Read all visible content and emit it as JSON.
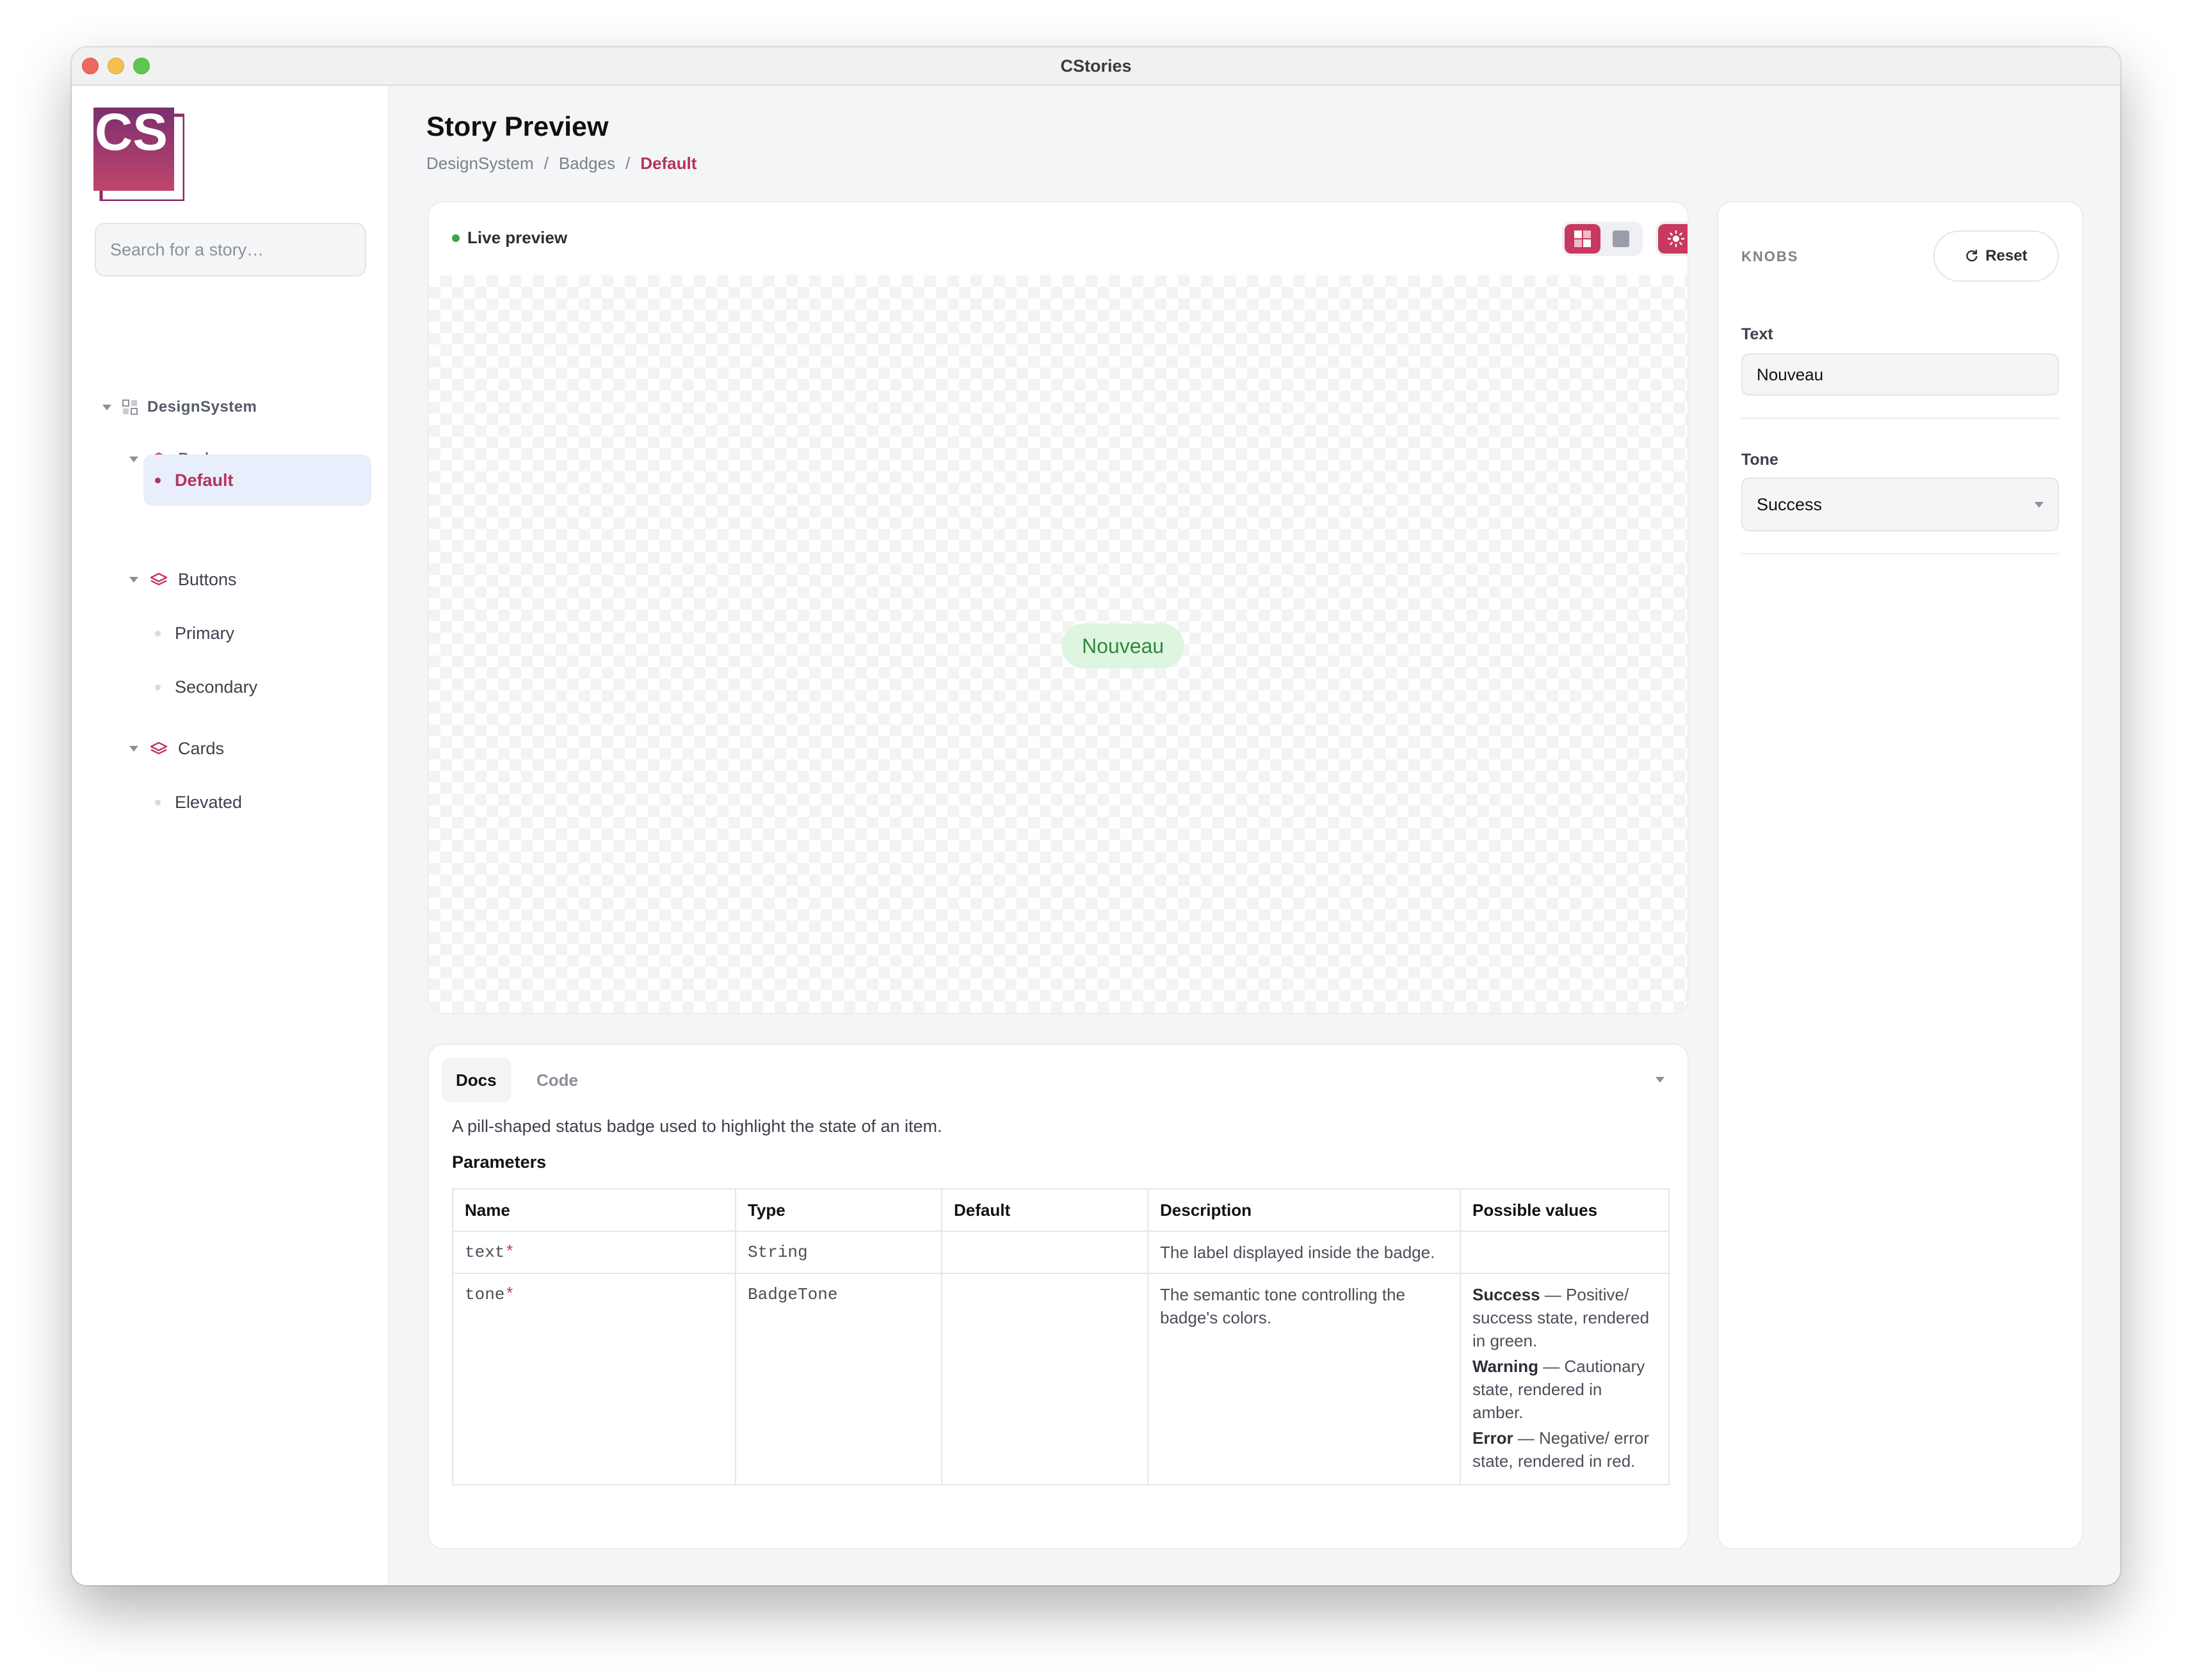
{
  "window": {
    "title": "CStories"
  },
  "sidebar": {
    "logo_text": "CS",
    "search_placeholder": "Search for a story…",
    "root": {
      "label": "DesignSystem"
    },
    "groups": [
      {
        "label": "Badges",
        "items": [
          {
            "label": "Default",
            "active": true
          }
        ]
      },
      {
        "label": "Buttons",
        "items": [
          {
            "label": "Primary"
          },
          {
            "label": "Secondary"
          }
        ]
      },
      {
        "label": "Cards",
        "items": [
          {
            "label": "Elevated"
          }
        ]
      }
    ]
  },
  "header": {
    "title": "Story Preview",
    "breadcrumb": [
      "DesignSystem",
      "/",
      "Badges",
      "/",
      "Default"
    ]
  },
  "preview": {
    "live_label": "Live preview",
    "badge_text": "Nouveau"
  },
  "docs": {
    "tabs": [
      "Docs",
      "Code"
    ],
    "description": "A pill-shaped status badge used to highlight the state of an item.",
    "parameters_heading": "Parameters",
    "columns": [
      "Name",
      "Type",
      "Default",
      "Description",
      "Possible values"
    ],
    "rows": [
      {
        "name": "text",
        "required": "*",
        "type": "String",
        "default": "",
        "description": "The label displayed inside the badge."
      },
      {
        "name": "tone",
        "required": "*",
        "type": "BadgeTone",
        "default": "",
        "description": "The semantic tone controlling the badge's colors.",
        "values": [
          {
            "name": "Success",
            "text": " — Positive/ success state, rendered in green."
          },
          {
            "name": "Warning",
            "text": " — Cautionary state, rendered in amber."
          },
          {
            "name": "Error",
            "text": " — Negative/ error state, rendered in red."
          }
        ]
      }
    ]
  },
  "knobs": {
    "title": "KNOBS",
    "reset_label": "Reset",
    "text_label": "Text",
    "text_value": "Nouveau",
    "tone_label": "Tone",
    "tone_value": "Success"
  },
  "colors": {
    "accent": "#c8385f",
    "success_badge_bg": "#def5e1",
    "success_badge_fg": "#2e8a3c",
    "live_dot": "#3fa34d"
  }
}
